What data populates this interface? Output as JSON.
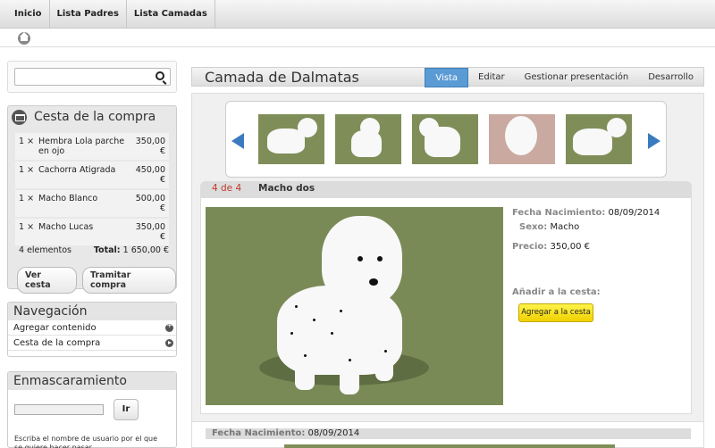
{
  "nav": {
    "items": [
      "Inicio",
      "Lista Padres",
      "Lista Camadas"
    ]
  },
  "search": {
    "placeholder": ""
  },
  "cart": {
    "title": "Cesta de la compra",
    "items": [
      {
        "qty": "1 ×",
        "name": "Hembra Lola parche en ojo",
        "price": "350,00 €"
      },
      {
        "qty": "1 ×",
        "name": "Cachorra Atigrada",
        "price": "450,00 €"
      },
      {
        "qty": "1 ×",
        "name": "Macho Blanco",
        "price": "500,00 €"
      },
      {
        "qty": "1 ×",
        "name": "Macho Lucas",
        "price": "350,00 €"
      }
    ],
    "count_label": "4 elementos",
    "total_label": "Total:",
    "total_value": "1 650,00 €",
    "view_label": "Ver cesta",
    "checkout_label": "Tramitar compra"
  },
  "navigation": {
    "title": "Navegación",
    "links": [
      "Agregar contenido",
      "Cesta de la compra"
    ]
  },
  "masking": {
    "title": "Enmascaramiento",
    "go_label": "Ir",
    "hint": "Escriba el nombre de usuario por el que se quiere hacer pasar"
  },
  "page": {
    "title": "Camada de Dalmatas",
    "tabs": [
      "Vista",
      "Editar",
      "Gestionar presentación",
      "Desarrollo"
    ],
    "active_tab": "Vista"
  },
  "detail": {
    "counter": "4 de 4",
    "name": "Macho dos",
    "birth_label": "Fecha Nacimiento:",
    "birth_value": "08/09/2014",
    "sex_label": "Sexo:",
    "sex_value": "Macho",
    "price_label": "Precio:",
    "price_value": "350,00 €",
    "add_label": "Añadir a la cesta:",
    "add_button": "Agregar a la cesta"
  },
  "lower": {
    "birth_label": "Fecha Nacimiento:",
    "birth_value": "08/09/2014"
  },
  "colors": {
    "accent": "#5b9bd5",
    "add_button": "#f7e21c",
    "counter": "#c0392b"
  }
}
